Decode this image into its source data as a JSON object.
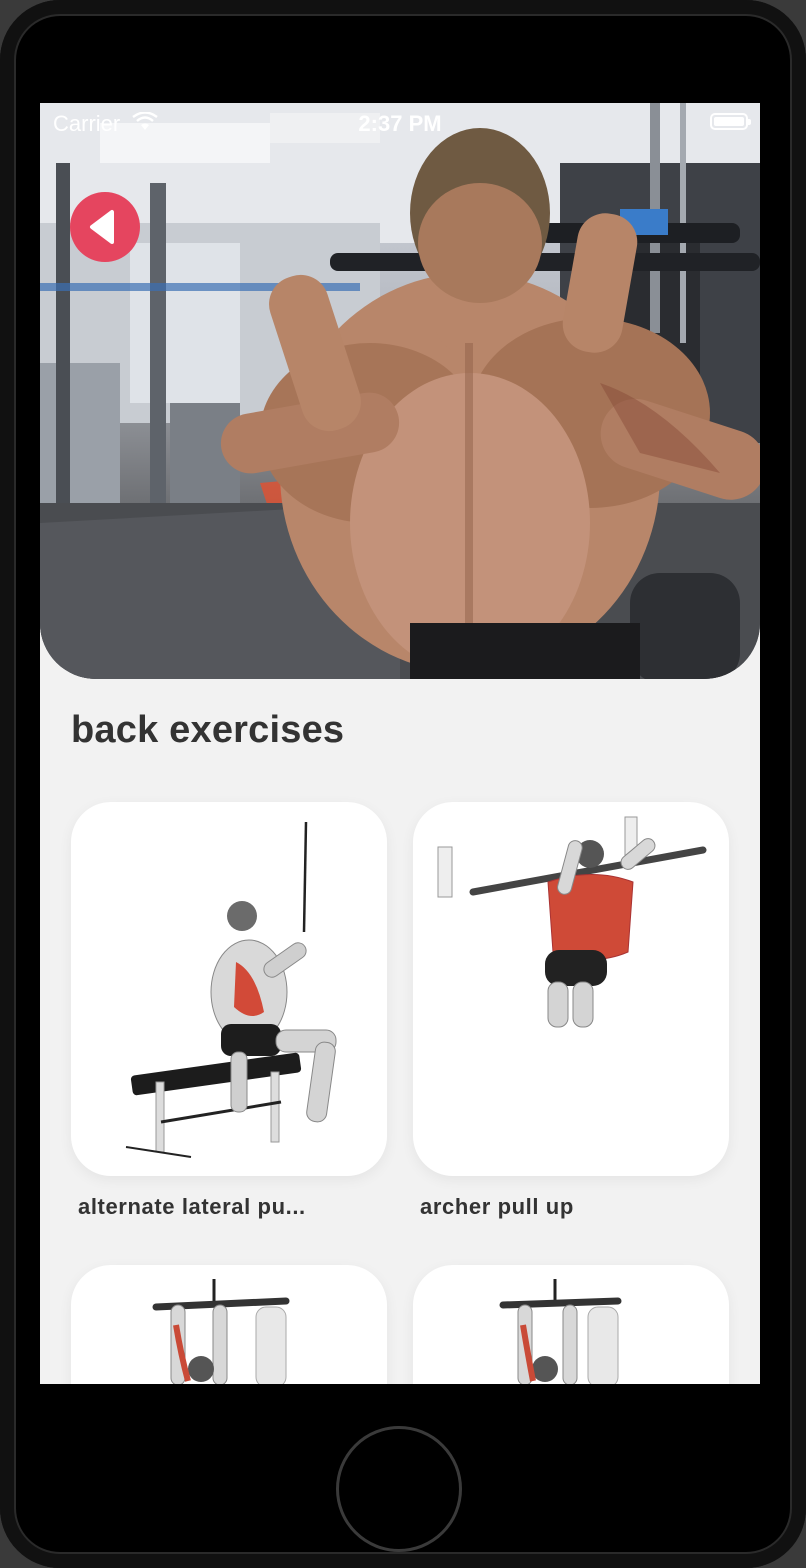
{
  "status_bar": {
    "carrier": "Carrier",
    "time": "2:37 PM",
    "wifi_icon": "wifi-icon",
    "battery_icon": "battery-full-icon"
  },
  "header": {
    "back_icon": "chevron-left-icon",
    "back_color": "#e5455f"
  },
  "section": {
    "title": "back exercises"
  },
  "exercises": [
    {
      "label": "alternate lateral pu..."
    },
    {
      "label": "archer pull up"
    },
    {
      "label": ""
    },
    {
      "label": ""
    }
  ],
  "colors": {
    "accent": "#e5455f",
    "background": "#f2f2f2",
    "card": "#ffffff",
    "text": "#333333"
  }
}
